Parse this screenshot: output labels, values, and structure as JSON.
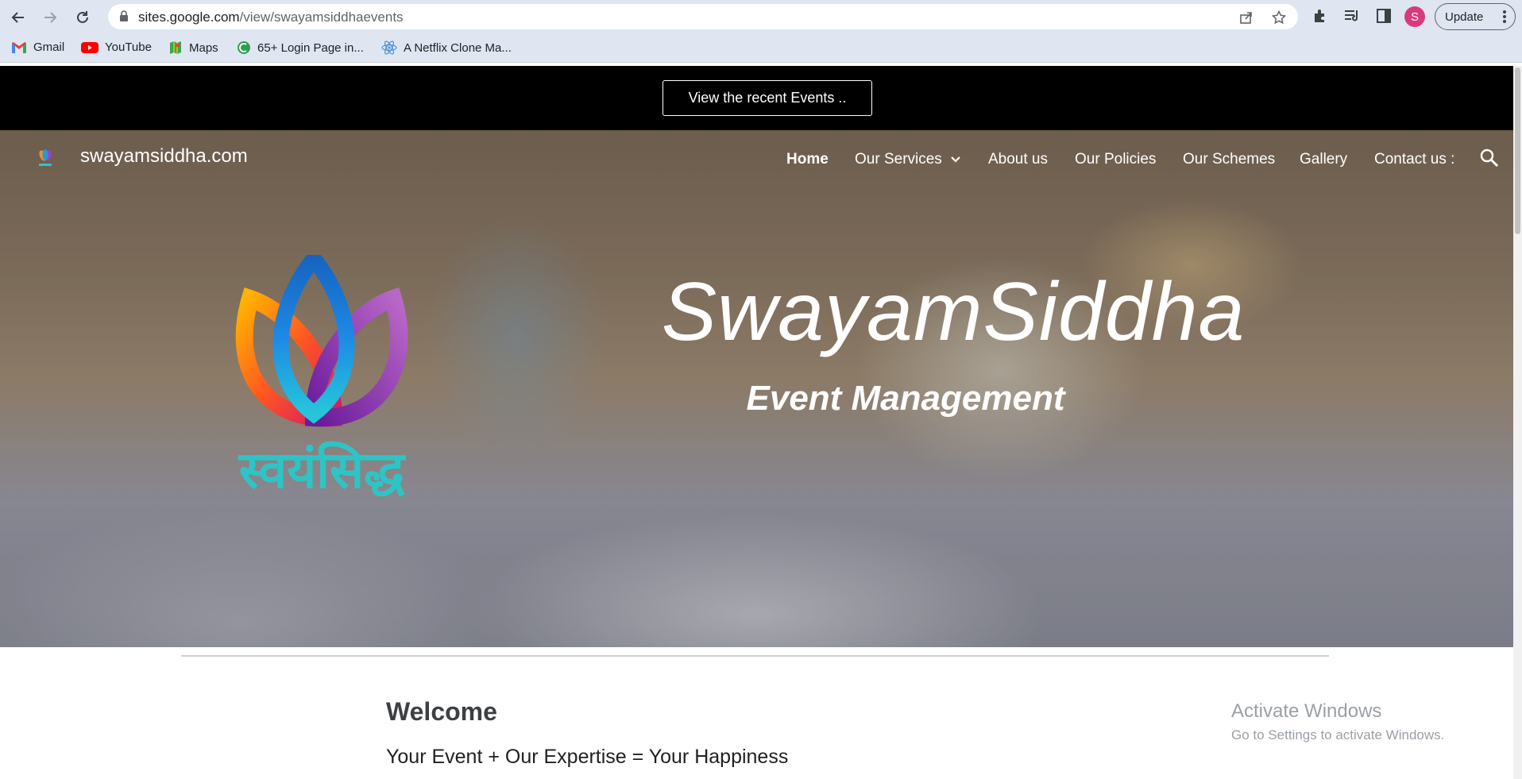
{
  "browser": {
    "url_host": "sites.google.com",
    "url_path": "/view/swayamsiddhaevents",
    "profile_initial": "S",
    "update_label": "Update",
    "bookmarks": [
      {
        "label": "Gmail",
        "icon": "gmail-icon"
      },
      {
        "label": "YouTube",
        "icon": "youtube-icon"
      },
      {
        "label": "Maps",
        "icon": "maps-icon"
      },
      {
        "label": "65+ Login Page in...",
        "icon": "site-favicon-icon"
      },
      {
        "label": "A Netflix Clone Ma...",
        "icon": "react-icon"
      }
    ]
  },
  "announcement": {
    "button_label": "View the recent Events .."
  },
  "site": {
    "name": "swayamsiddha.com",
    "nav": [
      {
        "label": "Home",
        "active": true
      },
      {
        "label": "Our Services",
        "has_dropdown": true
      },
      {
        "label": "About us"
      },
      {
        "label": "Our Policies"
      },
      {
        "label": "Our Schemes"
      },
      {
        "label": "Gallery"
      },
      {
        "label": "Contact us :"
      }
    ]
  },
  "hero": {
    "logo_text": "स्वयंसिद्ध",
    "title": "SwayamSiddha",
    "subtitle": "Event Management"
  },
  "content": {
    "heading": "Welcome",
    "tagline": "Your Event + Our Expertise = Your Happiness"
  },
  "watermark": {
    "line1": "Activate Windows",
    "line2": "Go to Settings to activate Windows."
  },
  "colors": {
    "logo_text": "#2ec4c6",
    "announcement_bg": "#000000",
    "profile_bg": "#d93a7e"
  }
}
